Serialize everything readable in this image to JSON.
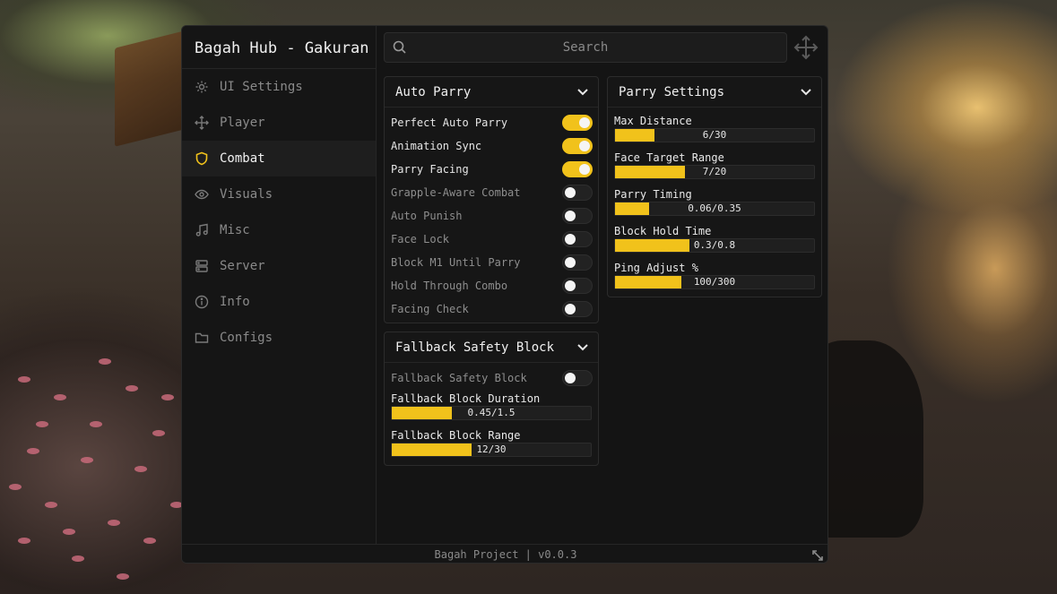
{
  "app": {
    "title": "Bagah Hub - Gakuran",
    "footer": "Bagah Project | v0.0.3",
    "accent": "#f1c21b"
  },
  "search": {
    "placeholder": "Search"
  },
  "sidebar": {
    "items": [
      {
        "label": "UI Settings",
        "icon": "gear-icon",
        "active": false
      },
      {
        "label": "Player",
        "icon": "move-icon",
        "active": false
      },
      {
        "label": "Combat",
        "icon": "shield-icon",
        "active": true
      },
      {
        "label": "Visuals",
        "icon": "eye-icon",
        "active": false
      },
      {
        "label": "Misc",
        "icon": "music-note-icon",
        "active": false
      },
      {
        "label": "Server",
        "icon": "server-icon",
        "active": false
      },
      {
        "label": "Info",
        "icon": "info-icon",
        "active": false
      },
      {
        "label": "Configs",
        "icon": "folder-icon",
        "active": false
      }
    ]
  },
  "auto_parry": {
    "title": "Auto Parry",
    "toggles": [
      {
        "label": "Perfect Auto Parry",
        "on": true
      },
      {
        "label": "Animation Sync",
        "on": true
      },
      {
        "label": "Parry Facing",
        "on": true
      },
      {
        "label": "Grapple-Aware Combat",
        "on": false
      },
      {
        "label": "Auto Punish",
        "on": false
      },
      {
        "label": "Face Lock",
        "on": false
      },
      {
        "label": "Block M1 Until Parry",
        "on": false
      },
      {
        "label": "Hold Through Combo",
        "on": false
      },
      {
        "label": "Facing Check",
        "on": false
      }
    ]
  },
  "fallback": {
    "title": "Fallback Safety Block",
    "toggle": {
      "label": "Fallback Safety Block",
      "on": false
    },
    "sliders": [
      {
        "label": "Fallback Block Duration",
        "text": "0.45/1.5",
        "fraction": 0.3
      },
      {
        "label": "Fallback Block Range",
        "text": "12/30",
        "fraction": 0.4
      }
    ]
  },
  "parry_settings": {
    "title": "Parry Settings",
    "sliders": [
      {
        "label": "Max Distance",
        "text": "6/30",
        "fraction": 0.2
      },
      {
        "label": "Face Target Range",
        "text": "7/20",
        "fraction": 0.35
      },
      {
        "label": "Parry Timing",
        "text": "0.06/0.35",
        "fraction": 0.171
      },
      {
        "label": "Block Hold Time",
        "text": "0.3/0.8",
        "fraction": 0.375
      },
      {
        "label": "Ping Adjust %",
        "text": "100/300",
        "fraction": 0.333
      }
    ]
  }
}
